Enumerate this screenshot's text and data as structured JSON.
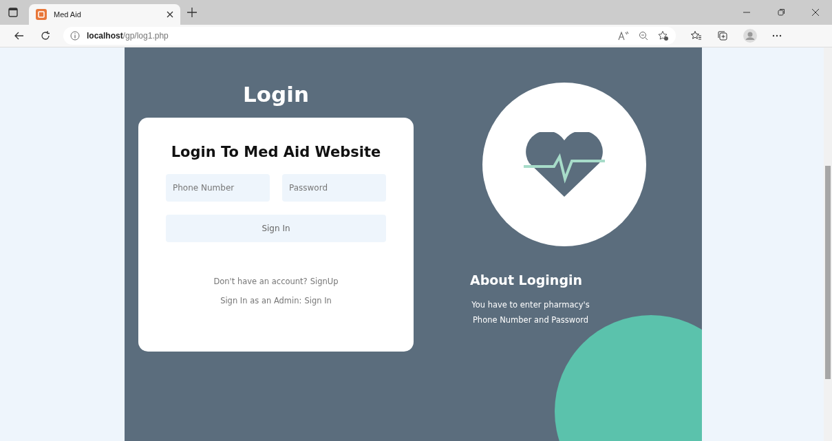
{
  "browser": {
    "tab": {
      "title": "Med Aid",
      "selected": true
    },
    "address": {
      "host": "localhost",
      "path": "/gp/log1.php"
    }
  },
  "page": {
    "title": "Login",
    "card": {
      "heading": "Login To Med Aid Website",
      "fields": [
        {
          "placeholder": "Phone Number"
        },
        {
          "placeholder": "Password"
        }
      ],
      "button": "Sign In",
      "links": [
        {
          "text": "Don't have an account?",
          "link": "SignUp"
        },
        {
          "text": "Sign In as an Admin:",
          "link": "Sign In"
        }
      ]
    },
    "about": {
      "title": "About Logingin",
      "text": "You have to enter pharmacy's Phone Number and Password"
    }
  }
}
